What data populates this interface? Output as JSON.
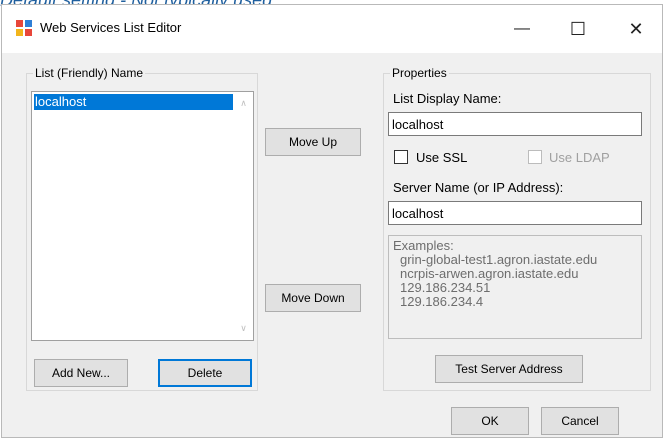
{
  "background_text": "Default setting - Not typically used",
  "window": {
    "title": "Web Services List Editor",
    "minimize_glyph": "—",
    "maximize_glyph": "☐",
    "close_glyph": "✕"
  },
  "list_group": {
    "label": "List (Friendly) Name",
    "items": [
      "localhost"
    ],
    "selected_index": 0
  },
  "buttons": {
    "move_up": "Move Up",
    "move_down": "Move Down",
    "add_new": "Add New...",
    "delete": "Delete",
    "test_server": "Test Server Address",
    "ok": "OK",
    "cancel": "Cancel"
  },
  "properties": {
    "label": "Properties",
    "display_name_label": "List Display Name:",
    "display_name_value": "localhost",
    "use_ssl_label": "Use SSL",
    "use_ssl_checked": false,
    "use_ldap_label": "Use LDAP",
    "use_ldap_checked": false,
    "use_ldap_enabled": false,
    "server_name_label": "Server Name (or IP Address):",
    "server_name_value": "localhost",
    "examples_header": "Examples:",
    "examples": [
      "grin-global-test1.agron.iastate.edu",
      "ncrpis-arwen.agron.iastate.edu",
      "129.186.234.51",
      "129.186.234.4"
    ]
  },
  "icons": {
    "app": "app-window-icon",
    "scroll_up": "chevron-up-icon",
    "scroll_down": "chevron-down-icon"
  },
  "colors": {
    "selection": "#0078d7",
    "dialog_bg": "#f0f0f0",
    "focus_border": "#0078d7"
  }
}
